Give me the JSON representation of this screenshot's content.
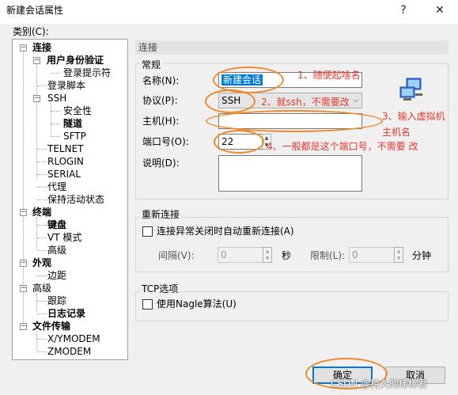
{
  "window": {
    "title": "新建会话属性",
    "help_label": "?",
    "close_label": "✕"
  },
  "category_label": "类别(C):",
  "tree": {
    "connection": "连接",
    "auth": "用户身份验证",
    "login_prompt": "登录提示符",
    "login_script": "登录脚本",
    "ssh": "SSH",
    "security": "安全性",
    "tunnel": "隧道",
    "sftp": "SFTP",
    "telnet": "TELNET",
    "rlogin": "RLOGIN",
    "serial": "SERIAL",
    "proxy": "代理",
    "keepalive": "保持活动状态",
    "terminal": "终端",
    "keyboard": "键盘",
    "vt_mode": "VT 模式",
    "advanced": "高级",
    "appearance": "外观",
    "margin": "边距",
    "advanced2": "高级",
    "trace": "跟踪",
    "log": "日志记录",
    "file_transfer": "文件传输",
    "xymodem": "X/YMODEM",
    "zmodem": "ZMODEM",
    "toggle_minus": "−"
  },
  "section_title": "连接",
  "general": {
    "title": "常规",
    "name_label": "名称(N):",
    "name_value": "新建会话",
    "protocol_label": "协议(P):",
    "protocol_value": "SSH",
    "host_label": "主机(H):",
    "host_value": "",
    "port_label": "端口号(O):",
    "port_value": "22",
    "desc_label": "说明(D):",
    "desc_value": ""
  },
  "reconnect": {
    "title": "重新连接",
    "auto_label": "连接异常关闭时自动重新连接(A)",
    "interval_label": "间隔(V):",
    "interval_value": "0",
    "sec_unit": "秒",
    "limit_label": "限制(L):",
    "limit_value": "0",
    "min_unit": "分钟"
  },
  "tcp": {
    "title": "TCP选项",
    "nagle_label": "使用Nagle算法(U)"
  },
  "buttons": {
    "ok": "确定",
    "cancel": "取消"
  },
  "annotations": {
    "a1": "1、随便起啥名",
    "a2": "2、就ssh，不需要改",
    "a3_line1": "3、输入虚拟机",
    "a3_line2": "主机名",
    "a4": "4、一般都是这个端口号，不需要 改"
  },
  "watermark": "CSDN @持久的棒棒君",
  "colors": {
    "annotation": "#e8372f",
    "circle": "#ee8a2b",
    "selection": "#0078d7"
  }
}
